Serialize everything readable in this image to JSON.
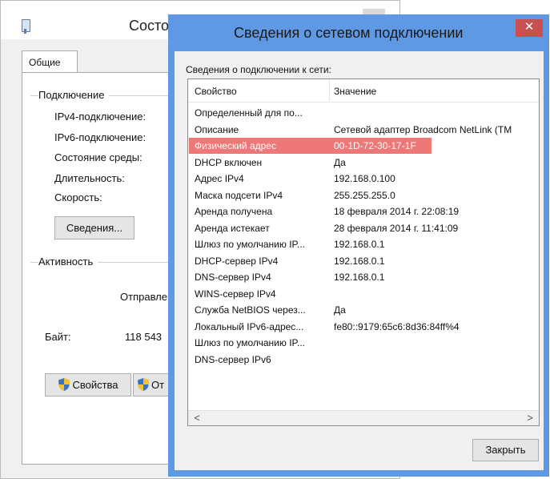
{
  "background_window": {
    "title_fragment": "Состо",
    "tab_label": "Общие",
    "connection_group": "Подключение",
    "rows": [
      "IPv4-подключение:",
      "IPv6-подключение:",
      "Состояние среды:",
      "Длительность:",
      "Скорость:"
    ],
    "details_button": "Сведения...",
    "activity_group": "Активность",
    "sent_fragment": "Отправлен",
    "bytes_label": "Байт:",
    "bytes_value": "118 543",
    "properties_button": "Свойства",
    "other_button_fragment": "От"
  },
  "details_window": {
    "title": "Сведения о сетевом подключении",
    "close_glyph": "✕",
    "caption": "Сведения о подключении к сети:",
    "columns": [
      "Свойство",
      "Значение"
    ],
    "rows": [
      {
        "property": "Определенный для по...",
        "value": ""
      },
      {
        "property": "Описание",
        "value": "Сетевой адаптер Broadcom NetLink (TM"
      },
      {
        "property": "Физический адрес",
        "value": "00-1D-72-30-17-1F"
      },
      {
        "property": "DHCP включен",
        "value": "Да"
      },
      {
        "property": "Адрес IPv4",
        "value": "192.168.0.100"
      },
      {
        "property": "Маска подсети IPv4",
        "value": "255.255.255.0"
      },
      {
        "property": "Аренда получена",
        "value": "18 февраля 2014 г. 22:08:19"
      },
      {
        "property": "Аренда истекает",
        "value": "28 февраля 2014 г. 11:41:09"
      },
      {
        "property": "Шлюз по умолчанию IP...",
        "value": "192.168.0.1"
      },
      {
        "property": "DHCP-сервер IPv4",
        "value": "192.168.0.1"
      },
      {
        "property": "DNS-сервер IPv4",
        "value": "192.168.0.1"
      },
      {
        "property": "WINS-сервер IPv4",
        "value": ""
      },
      {
        "property": "Служба NetBIOS через...",
        "value": "Да"
      },
      {
        "property": "Локальный IPv6-адрес...",
        "value": "fe80::9179:65c6:8d36:84ff%4"
      },
      {
        "property": "Шлюз по умолчанию IP...",
        "value": ""
      },
      {
        "property": "DNS-сервер IPv6",
        "value": ""
      }
    ],
    "highlighted_row": 2,
    "scroll_left_glyph": "<",
    "scroll_right_glyph": ">",
    "close_button": "Закрыть"
  },
  "colors": {
    "title_bar": "#5f99e4",
    "close_button": "#c75050",
    "highlight": "#ee7777",
    "highlight_text": "#ffffff"
  }
}
